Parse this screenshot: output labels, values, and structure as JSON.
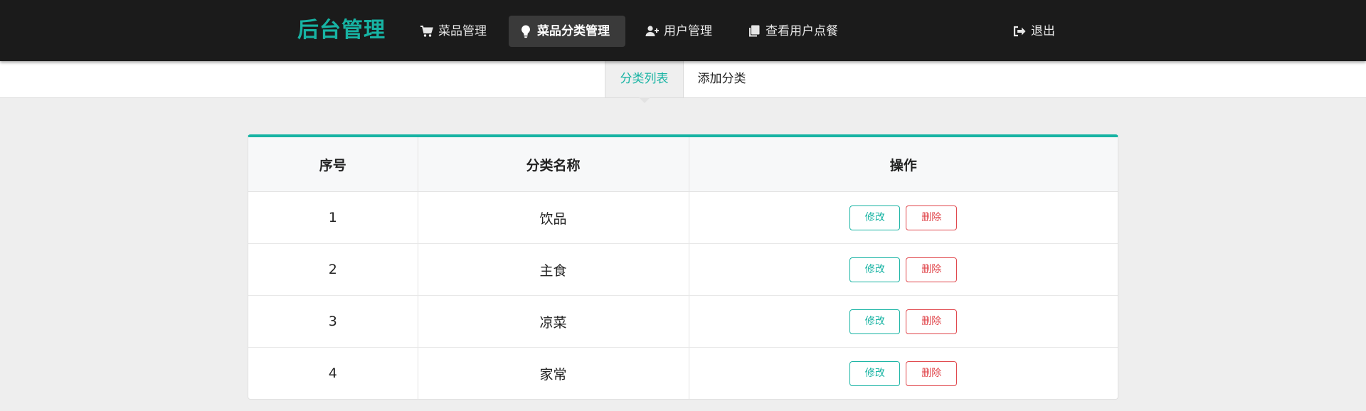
{
  "brand": "后台管理",
  "colors": {
    "accent": "#17b3a3",
    "danger": "#e0464b",
    "navbar": "#1b1b1b"
  },
  "nav": {
    "items": [
      {
        "label": "菜品管理",
        "icon": "cart-icon"
      },
      {
        "label": "菜品分类管理",
        "icon": "lightbulb-icon",
        "active": true
      },
      {
        "label": "用户管理",
        "icon": "user-plus-icon"
      },
      {
        "label": "查看用户点餐",
        "icon": "copy-icon"
      }
    ],
    "logout": {
      "label": "退出",
      "icon": "sign-out-icon"
    }
  },
  "subtabs": [
    {
      "label": "分类列表",
      "active": true
    },
    {
      "label": "添加分类"
    }
  ],
  "table": {
    "headers": [
      "序号",
      "分类名称",
      "操作"
    ],
    "rows": [
      {
        "index": "1",
        "name": "饮品"
      },
      {
        "index": "2",
        "name": "主食"
      },
      {
        "index": "3",
        "name": "凉菜"
      },
      {
        "index": "4",
        "name": "家常"
      }
    ],
    "edit_label": "修改",
    "delete_label": "删除"
  }
}
